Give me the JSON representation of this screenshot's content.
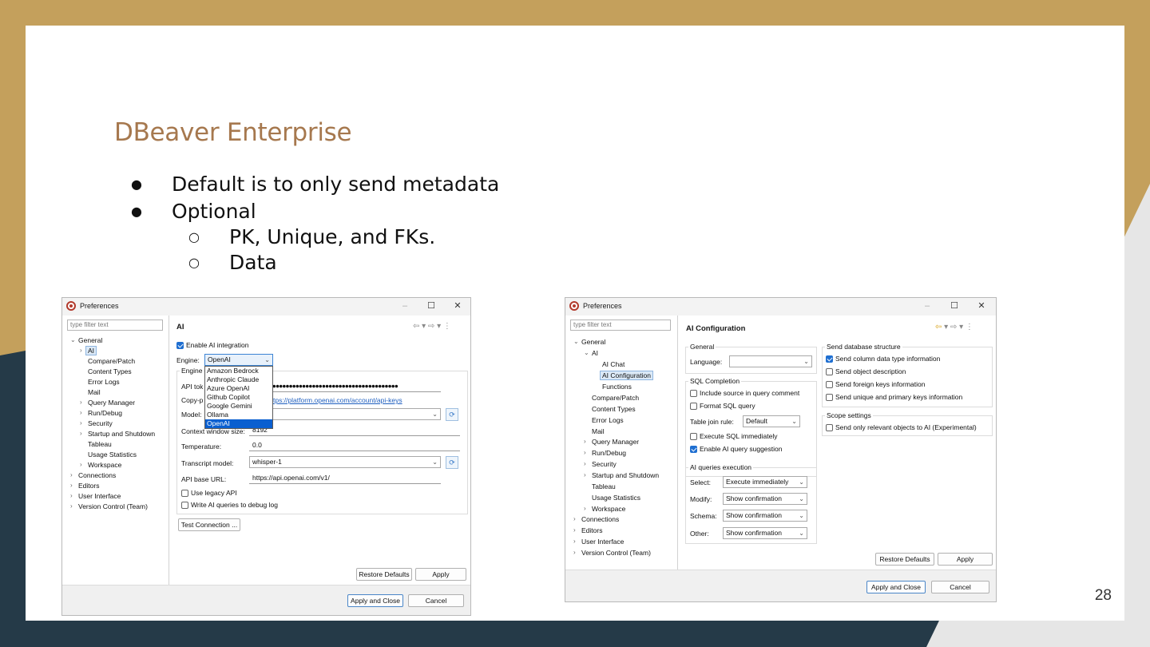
{
  "slide": {
    "title": "DBeaver Enterprise",
    "bullets": [
      {
        "marker": "●",
        "text": "Default is to only send metadata"
      },
      {
        "marker": "●",
        "text": "Optional"
      },
      {
        "marker": "○",
        "text": "PK, Unique, and FKs."
      },
      {
        "marker": "○",
        "text": "Data"
      }
    ],
    "page_number": "28"
  },
  "colors": {
    "title": "#a6784e",
    "tan_background": "#c4a05c",
    "dark_background": "#253a48",
    "selection_blue": "#0a5fd0"
  },
  "left": {
    "window_title": "Preferences",
    "controls": {
      "minimize": "–",
      "maximize": "☐",
      "close": "✕"
    },
    "filter_placeholder": "type filter text",
    "tree": [
      "General",
      "AI",
      "Compare/Patch",
      "Content Types",
      "Error Logs",
      "Mail",
      "Query Manager",
      "Run/Debug",
      "Security",
      "Startup and Shutdown",
      "Tableau",
      "Usage Statistics",
      "Workspace",
      "Connections",
      "Editors",
      "User Interface",
      "Version Control (Team)"
    ],
    "page_title": "AI",
    "nav_icons": "⇦ ▾ ⇨ ▾ ⋮",
    "enable_label": "Enable AI integration",
    "engine_label": "Engine:",
    "engine_value": "OpenAI",
    "engine_options": [
      "Amazon Bedrock",
      "Anthropic Claude",
      "Azure OpenAI",
      "Github Copilot",
      "Google Gemini",
      "Ollama",
      "OpenAI"
    ],
    "engine_group_label": "Engine",
    "api_token_label": "API tok",
    "api_token_value": "●●●●●●●●●●●●●●●●●●●●●●●●●●●●●●●●●●●●●●●●●●●●",
    "copy_label": "Copy-p",
    "copy_link": "tps://platform.openai.com/account/api-keys",
    "model_label": "Model:",
    "context_label": "Context window size:",
    "context_value": "8192",
    "temperature_label": "Temperature:",
    "temperature_value": "0.0",
    "transcript_label": "Transcript model:",
    "transcript_value": "whisper-1",
    "base_url_label": "API base URL:",
    "base_url_value": "https://api.openai.com/v1/",
    "legacy_label": "Use legacy API",
    "debug_label": "Write AI queries to debug log",
    "test_button": "Test Connection ...",
    "restore_button": "Restore Defaults",
    "apply_button": "Apply",
    "apply_close_button": "Apply and Close",
    "cancel_button": "Cancel"
  },
  "right": {
    "window_title": "Preferences",
    "controls": {
      "minimize": "–",
      "maximize": "☐",
      "close": "✕"
    },
    "filter_placeholder": "type filter text",
    "tree": [
      "General",
      "AI",
      "AI Chat",
      "AI Configuration",
      "Functions",
      "Compare/Patch",
      "Content Types",
      "Error Logs",
      "Mail",
      "Query Manager",
      "Run/Debug",
      "Security",
      "Startup and Shutdown",
      "Tableau",
      "Usage Statistics",
      "Workspace",
      "Connections",
      "Editors",
      "User Interface",
      "Version Control (Team)"
    ],
    "page_title": "AI Configuration",
    "nav_back": "⇦",
    "nav_rest": "▾ ⇨ ▾ ⋮",
    "general_group": "General",
    "language_label": "Language:",
    "sql_group": "SQL Completion",
    "include_source": "Include source in query comment",
    "format_sql": "Format SQL query",
    "join_rule_label": "Table join rule:",
    "join_rule_value": "Default",
    "execute_immediately": "Execute SQL immediately",
    "enable_suggestion": "Enable AI query suggestion",
    "exec_group": "AI queries execution",
    "select_label": "Select:",
    "select_value": "Execute immediately",
    "modify_label": "Modify:",
    "modify_value": "Show confirmation",
    "schema_label": "Schema:",
    "schema_value": "Show confirmation",
    "other_label": "Other:",
    "other_value": "Show confirmation",
    "structure_group": "Send database structure",
    "send_column": "Send column data type information",
    "send_object": "Send object description",
    "send_fk": "Send foreign keys information",
    "send_unique": "Send unique and primary keys information",
    "scope_group": "Scope settings",
    "send_relevant": "Send only relevant objects to AI (Experimental)",
    "restore_button": "Restore Defaults",
    "apply_button": "Apply",
    "apply_close_button": "Apply and Close",
    "cancel_button": "Cancel"
  }
}
